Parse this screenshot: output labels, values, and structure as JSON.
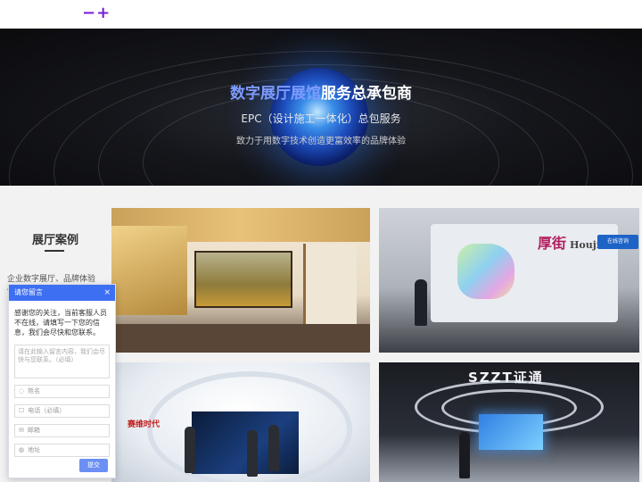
{
  "header": {
    "logo_text": "−+"
  },
  "hero": {
    "title_accent": "数字展厅展馆",
    "title_rest": "服务总承包商",
    "subtitle": "EPC（设计施工一体化）总包服务",
    "tagline": "致力于用数字技术创造更富效率的品牌体验"
  },
  "side": {
    "title": "展厅案例",
    "description": "企业数字展厅、品牌体验馆、"
  },
  "cards": {
    "card2_brand": "厚街",
    "card2_brand_en": "Houjie",
    "card2_chat_label": "在线咨询",
    "card3_logo": "赛维时代",
    "card4_title": "SZZT证通"
  },
  "message_panel": {
    "header": "请您留言",
    "close": "×",
    "intro": "感谢您的关注，当前客服人员不在线，请填写一下您的信息，我们会尽快和您联系。",
    "message_placeholder": "请在此输入留言内容，我们会尽快与您联系。（必填）",
    "name_placeholder": "姓名",
    "phone_placeholder": "电话（必填）",
    "email_placeholder": "邮箱",
    "address_placeholder": "地址",
    "submit_label": "提交",
    "field_icons": [
      "user-icon",
      "phone-icon",
      "mail-icon",
      "location-icon"
    ]
  },
  "colors": {
    "brand_purple": "#7a1fd6",
    "accent_blue": "#3d6ff2",
    "hero_accent": "#7d9bff"
  }
}
